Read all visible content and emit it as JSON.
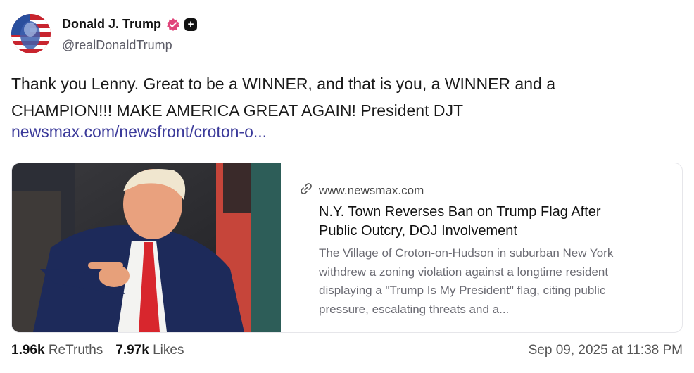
{
  "author": {
    "name": "Donald J. Trump",
    "handle": "@realDonaldTrump",
    "verified_color": "#e0457b",
    "badge": "+"
  },
  "post": {
    "line1": "Thank you Lenny. Great to be a WINNER, and that is you, a WINNER and a",
    "line2": "CHAMPION!!! MAKE AMERICA GREAT AGAIN! President DJT",
    "link": "newsmax.com/newsfront/croton-o..."
  },
  "card": {
    "domain_icon": "link-icon",
    "domain": "www.newsmax.com",
    "title_line1": "N.Y. Town Reverses Ban on Trump Flag After",
    "title_line2": "Public Outcry, DOJ Involvement",
    "desc_line1": "The Village of Croton-on-Hudson in suburban New York",
    "desc_line2": "withdrew a zoning violation against a longtime resident",
    "desc_line3": "displaying a \"Trump Is My President\" flag, citing public",
    "desc_line4": "pressure, escalating threats and a..."
  },
  "stats": {
    "retruths_count": "1.96k",
    "retruths_label": "ReTruths",
    "likes_count": "7.97k",
    "likes_label": "Likes"
  },
  "timestamp": "Sep 09, 2025 at 11:38 PM",
  "colors": {
    "link": "#3b3a9a",
    "text": "#1a1a1a",
    "muted": "#6b6b73"
  }
}
